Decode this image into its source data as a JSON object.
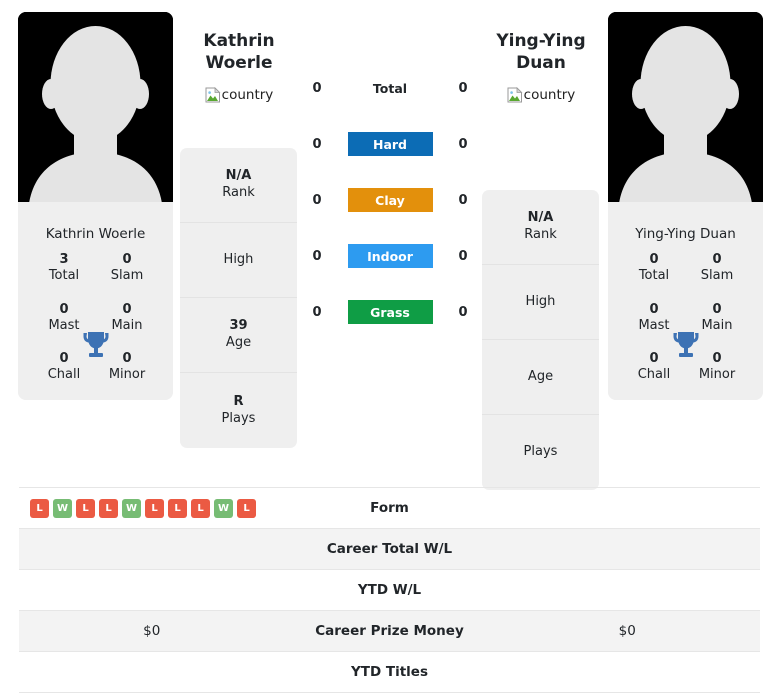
{
  "players": {
    "left": {
      "name": "Kathrin Woerle",
      "name_line1": "Kathrin",
      "name_line2": "Woerle",
      "country_alt": "country",
      "card_name": "Kathrin Woerle",
      "trophies": [
        {
          "value": "3",
          "label": "Total"
        },
        {
          "value": "0",
          "label": "Slam"
        },
        {
          "value": "0",
          "label": "Mast"
        },
        {
          "value": "0",
          "label": "Main"
        },
        {
          "value": "0",
          "label": "Chall"
        },
        {
          "value": "0",
          "label": "Minor"
        }
      ],
      "info": [
        {
          "value": "N/A",
          "label": "Rank"
        },
        {
          "value": "",
          "label": "High"
        },
        {
          "value": "39",
          "label": "Age"
        },
        {
          "value": "R",
          "label": "Plays"
        }
      ],
      "form": [
        "L",
        "W",
        "L",
        "L",
        "W",
        "L",
        "L",
        "L",
        "W",
        "L"
      ],
      "career_total_wl": "",
      "ytd_wl": "",
      "career_prize_money": "$0",
      "ytd_titles": ""
    },
    "right": {
      "name": "Ying-Ying Duan",
      "name_line1": "Ying-Ying",
      "name_line2": "Duan",
      "country_alt": "country",
      "card_name": "Ying-Ying Duan",
      "trophies": [
        {
          "value": "0",
          "label": "Total"
        },
        {
          "value": "0",
          "label": "Slam"
        },
        {
          "value": "0",
          "label": "Mast"
        },
        {
          "value": "0",
          "label": "Main"
        },
        {
          "value": "0",
          "label": "Chall"
        },
        {
          "value": "0",
          "label": "Minor"
        }
      ],
      "info": [
        {
          "value": "N/A",
          "label": "Rank"
        },
        {
          "value": "",
          "label": "High"
        },
        {
          "value": "",
          "label": "Age"
        },
        {
          "value": "",
          "label": "Plays"
        }
      ],
      "form": [],
      "career_total_wl": "",
      "ytd_wl": "",
      "career_prize_money": "$0",
      "ytd_titles": ""
    }
  },
  "surfaces": [
    {
      "label": "Total",
      "left": "0",
      "right": "0",
      "color": "transparent",
      "text_color": "#212529"
    },
    {
      "label": "Hard",
      "left": "0",
      "right": "0",
      "color": "#0C6CB5",
      "text_color": "#ffffff"
    },
    {
      "label": "Clay",
      "left": "0",
      "right": "0",
      "color": "#E3900C",
      "text_color": "#ffffff"
    },
    {
      "label": "Indoor",
      "left": "0",
      "right": "0",
      "color": "#2D9BF0",
      "text_color": "#ffffff"
    },
    {
      "label": "Grass",
      "left": "0",
      "right": "0",
      "color": "#0F9D45",
      "text_color": "#ffffff"
    }
  ],
  "comparison_rows": [
    {
      "label": "Form",
      "left": "",
      "right": ""
    },
    {
      "label": "Career Total W/L",
      "left": "",
      "right": ""
    },
    {
      "label": "YTD W/L",
      "left": "",
      "right": ""
    },
    {
      "label": "Career Prize Money",
      "left": "$0",
      "right": "$0"
    },
    {
      "label": "YTD Titles",
      "left": "",
      "right": ""
    }
  ],
  "colors": {
    "win_badge": "#77BC74",
    "loss_badge": "#EB5A43",
    "trophy": "#3D72B4",
    "card_bg": "#efefef",
    "row_alt_bg": "#f3f3f3"
  }
}
